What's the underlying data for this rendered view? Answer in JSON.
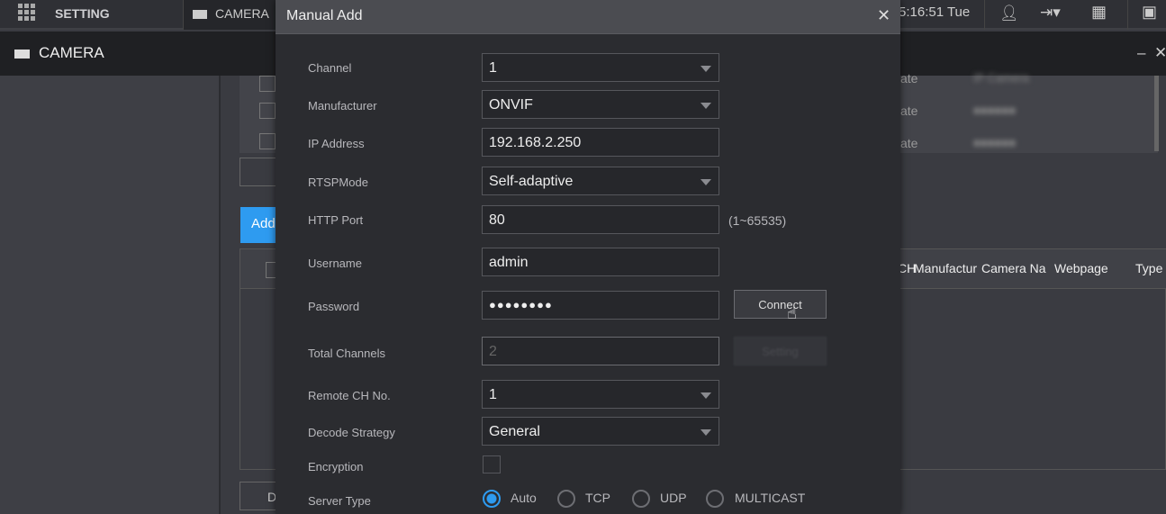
{
  "topbar": {
    "setting_label": "SETTING",
    "camera_tab": "CAMERA",
    "clock": "5:16:51 Tue",
    "icons": [
      "grid-icon",
      "camera-icon",
      "user-icon",
      "logout-icon",
      "qr-icon",
      "monitor-icon"
    ]
  },
  "subbar": {
    "title": "CAMERA",
    "minimize": "–",
    "close": "✕"
  },
  "background": {
    "add_button": "Add",
    "bottom_button": "D",
    "rows": [
      {
        "status": "ate",
        "type": "IP Camera"
      },
      {
        "status": "ate"
      },
      {
        "status": "ate"
      }
    ],
    "columns": [
      "CH",
      "Manufactur",
      "Camera Na",
      "Webpage",
      "Type"
    ]
  },
  "dialog": {
    "title": "Manual Add",
    "close": "✕",
    "fields": {
      "channel": {
        "label": "Channel",
        "value": "1"
      },
      "manufacturer": {
        "label": "Manufacturer",
        "value": "ONVIF"
      },
      "ip": {
        "label": "IP Address",
        "value": "192.168.2.250"
      },
      "rtsp": {
        "label": "RTSPMode",
        "value": "Self-adaptive"
      },
      "http": {
        "label": "HTTP Port",
        "value": "80",
        "hint": "(1~65535)"
      },
      "username": {
        "label": "Username",
        "value": "admin"
      },
      "password": {
        "label": "Password",
        "value": "●●●●●●●●"
      },
      "total": {
        "label": "Total Channels",
        "value": "2"
      },
      "remote": {
        "label": "Remote CH No.",
        "value": "1"
      },
      "decode": {
        "label": "Decode Strategy",
        "value": "General"
      },
      "encryption": {
        "label": "Encryption",
        "checked": false
      },
      "server": {
        "label": "Server Type",
        "options": [
          "Auto",
          "TCP",
          "UDP",
          "MULTICAST"
        ],
        "selected": "Auto"
      }
    },
    "connect_button": "Connect",
    "setting_button": "Setting"
  },
  "colors": {
    "accent": "#2e9bf0"
  }
}
